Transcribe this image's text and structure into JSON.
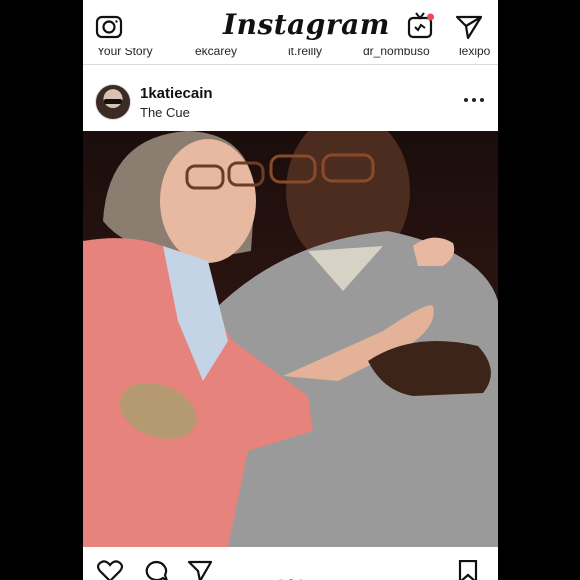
{
  "app": {
    "logo_text": "Instagram",
    "has_igtv_notification": true
  },
  "stories": [
    {
      "name": "Your Story"
    },
    {
      "name": "ekcarey"
    },
    {
      "name": "it.reilly"
    },
    {
      "name": "dr_nombuso"
    },
    {
      "name": "lexipo"
    }
  ],
  "post": {
    "username": "1katiecain",
    "location": "The Cue",
    "carousel": {
      "total": 3,
      "active_index": 1
    }
  },
  "colors": {
    "accent": "#3897f0",
    "notification": "#ed4956"
  }
}
